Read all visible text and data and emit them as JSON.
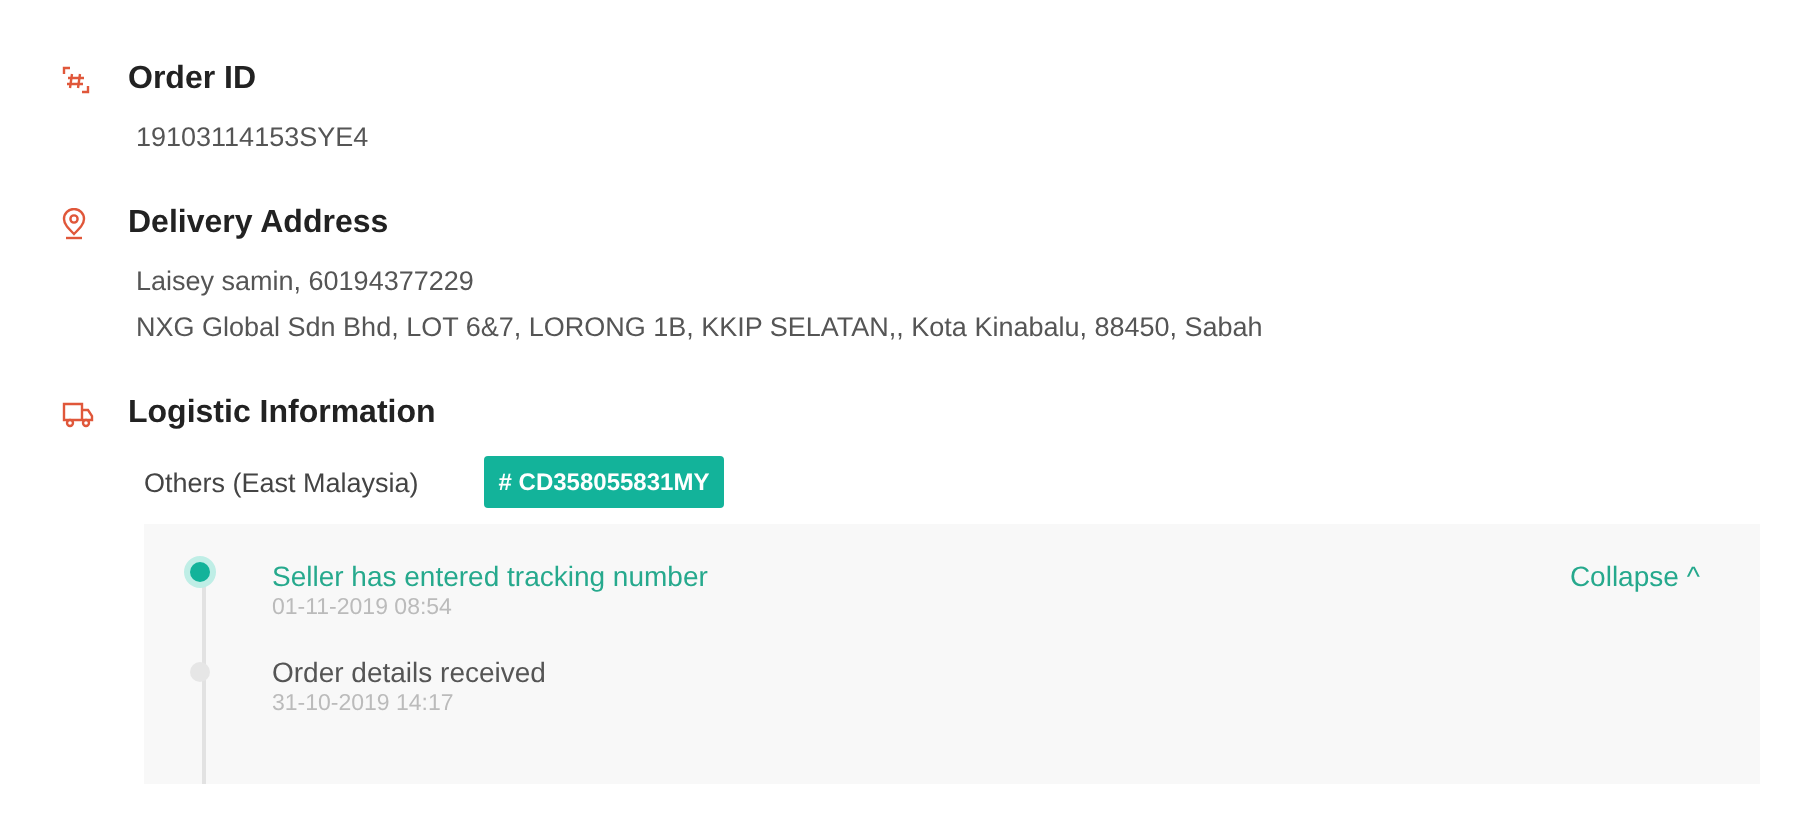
{
  "sections": [
    {
      "kind": "order",
      "title": "Order ID",
      "lines": [
        "19103114153SYE4"
      ]
    },
    {
      "kind": "address",
      "title": "Delivery Address",
      "lines": [
        "Laisey samin, 60194377229",
        "NXG Global Sdn Bhd, LOT 6&7, LORONG 1B, KKIP SELATAN,, Kota Kinabalu, 88450, Sabah"
      ]
    },
    {
      "kind": "logistic",
      "title": "Logistic Information",
      "carrier": "Others (East Malaysia)",
      "tracking_number": "# CD358055831MY",
      "toggle": "Collapse",
      "toggle_icon": "^",
      "events": [
        {
          "title": "Seller has entered tracking number",
          "time": "01-11-2019 08:54",
          "active": true
        },
        {
          "title": "Order details received",
          "time": "31-10-2019 14:17",
          "active": false
        }
      ]
    }
  ]
}
